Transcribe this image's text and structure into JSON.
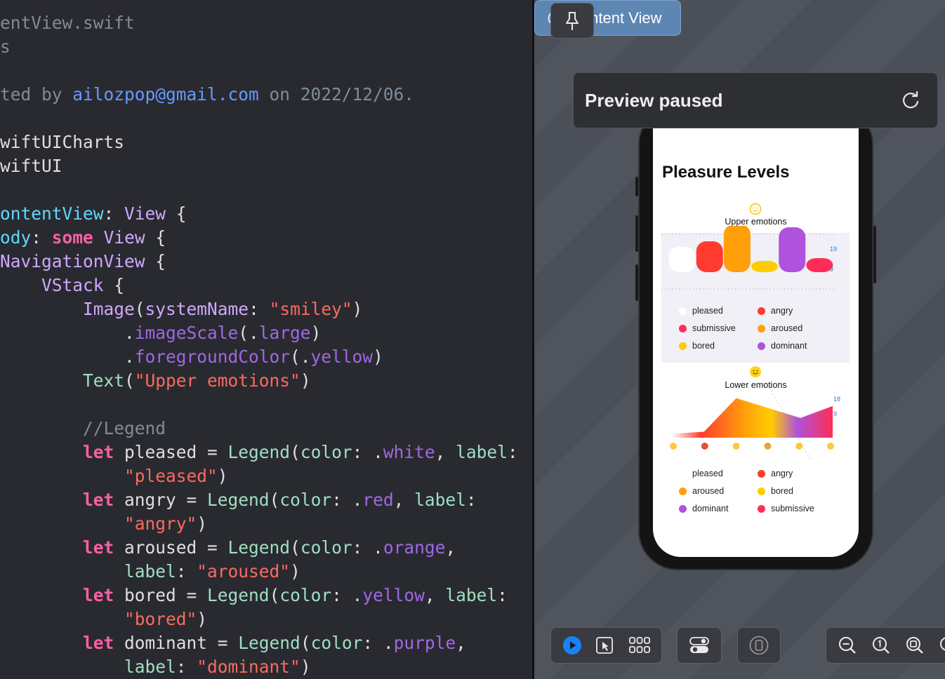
{
  "editor": {
    "lines": [
      [
        {
          "t": "entView.swift",
          "c": "comment"
        }
      ],
      [
        {
          "t": "s",
          "c": "comment"
        }
      ],
      [],
      [
        {
          "t": "ted by ",
          "c": "comment"
        },
        {
          "t": "ailozpop@gmail.com",
          "c": "link"
        },
        {
          "t": " on 2022/12/06.",
          "c": "comment"
        }
      ],
      [],
      [
        {
          "t": "wiftUICharts",
          "c": "plain"
        }
      ],
      [
        {
          "t": "wiftUI",
          "c": "plain"
        }
      ],
      [],
      [
        {
          "t": "ontentView",
          "c": "type"
        },
        {
          "t": ": ",
          "c": "plain"
        },
        {
          "t": "View",
          "c": "ptype"
        },
        {
          "t": " {",
          "c": "plain"
        }
      ],
      [
        {
          "t": "ody",
          "c": "type"
        },
        {
          "t": ": ",
          "c": "plain"
        },
        {
          "t": "some",
          "c": "kw"
        },
        {
          "t": " ",
          "c": "plain"
        },
        {
          "t": "View",
          "c": "ptype"
        },
        {
          "t": " {",
          "c": "plain"
        }
      ],
      [
        {
          "t": "NavigationView",
          "c": "ptype"
        },
        {
          "t": " {",
          "c": "plain"
        }
      ],
      [
        {
          "t": "    ",
          "c": "plain"
        },
        {
          "t": "VStack",
          "c": "ptype"
        },
        {
          "t": " {",
          "c": "plain"
        }
      ],
      [
        {
          "t": "        ",
          "c": "plain"
        },
        {
          "t": "Image",
          "c": "ptype"
        },
        {
          "t": "(",
          "c": "plain"
        },
        {
          "t": "systemName",
          "c": "ptype"
        },
        {
          "t": ": ",
          "c": "plain"
        },
        {
          "t": "\"smiley\"",
          "c": "str"
        },
        {
          "t": ")",
          "c": "plain"
        }
      ],
      [
        {
          "t": "            .",
          "c": "plain"
        },
        {
          "t": "imageScale",
          "c": "member"
        },
        {
          "t": "(.",
          "c": "plain"
        },
        {
          "t": "large",
          "c": "member"
        },
        {
          "t": ")",
          "c": "plain"
        }
      ],
      [
        {
          "t": "            .",
          "c": "plain"
        },
        {
          "t": "foregroundColor",
          "c": "member"
        },
        {
          "t": "(.",
          "c": "plain"
        },
        {
          "t": "yellow",
          "c": "member"
        },
        {
          "t": ")",
          "c": "plain"
        }
      ],
      [
        {
          "t": "        ",
          "c": "plain"
        },
        {
          "t": "Text",
          "c": "fn"
        },
        {
          "t": "(",
          "c": "plain"
        },
        {
          "t": "\"Upper emotions\"",
          "c": "str"
        },
        {
          "t": ")",
          "c": "plain"
        }
      ],
      [],
      [
        {
          "t": "        //Legend",
          "c": "comment"
        }
      ],
      [
        {
          "t": "        ",
          "c": "plain"
        },
        {
          "t": "let",
          "c": "kw"
        },
        {
          "t": " pleased = ",
          "c": "plain"
        },
        {
          "t": "Legend",
          "c": "fn"
        },
        {
          "t": "(",
          "c": "plain"
        },
        {
          "t": "color",
          "c": "param"
        },
        {
          "t": ": .",
          "c": "plain"
        },
        {
          "t": "white",
          "c": "member"
        },
        {
          "t": ", ",
          "c": "plain"
        },
        {
          "t": "label",
          "c": "param"
        },
        {
          "t": ":",
          "c": "plain"
        }
      ],
      [
        {
          "t": "            ",
          "c": "plain"
        },
        {
          "t": "\"pleased\"",
          "c": "str"
        },
        {
          "t": ")",
          "c": "plain"
        }
      ],
      [
        {
          "t": "        ",
          "c": "plain"
        },
        {
          "t": "let",
          "c": "kw"
        },
        {
          "t": " angry = ",
          "c": "plain"
        },
        {
          "t": "Legend",
          "c": "fn"
        },
        {
          "t": "(",
          "c": "plain"
        },
        {
          "t": "color",
          "c": "param"
        },
        {
          "t": ": .",
          "c": "plain"
        },
        {
          "t": "red",
          "c": "member"
        },
        {
          "t": ", ",
          "c": "plain"
        },
        {
          "t": "label",
          "c": "param"
        },
        {
          "t": ":",
          "c": "plain"
        }
      ],
      [
        {
          "t": "            ",
          "c": "plain"
        },
        {
          "t": "\"angry\"",
          "c": "str"
        },
        {
          "t": ")",
          "c": "plain"
        }
      ],
      [
        {
          "t": "        ",
          "c": "plain"
        },
        {
          "t": "let",
          "c": "kw"
        },
        {
          "t": " aroused = ",
          "c": "plain"
        },
        {
          "t": "Legend",
          "c": "fn"
        },
        {
          "t": "(",
          "c": "plain"
        },
        {
          "t": "color",
          "c": "param"
        },
        {
          "t": ": .",
          "c": "plain"
        },
        {
          "t": "orange",
          "c": "member"
        },
        {
          "t": ",",
          "c": "plain"
        }
      ],
      [
        {
          "t": "            ",
          "c": "plain"
        },
        {
          "t": "label",
          "c": "param"
        },
        {
          "t": ": ",
          "c": "plain"
        },
        {
          "t": "\"aroused\"",
          "c": "str"
        },
        {
          "t": ")",
          "c": "plain"
        }
      ],
      [
        {
          "t": "        ",
          "c": "plain"
        },
        {
          "t": "let",
          "c": "kw"
        },
        {
          "t": " bored = ",
          "c": "plain"
        },
        {
          "t": "Legend",
          "c": "fn"
        },
        {
          "t": "(",
          "c": "plain"
        },
        {
          "t": "color",
          "c": "param"
        },
        {
          "t": ": .",
          "c": "plain"
        },
        {
          "t": "yellow",
          "c": "member"
        },
        {
          "t": ", ",
          "c": "plain"
        },
        {
          "t": "label",
          "c": "param"
        },
        {
          "t": ":",
          "c": "plain"
        }
      ],
      [
        {
          "t": "            ",
          "c": "plain"
        },
        {
          "t": "\"bored\"",
          "c": "str"
        },
        {
          "t": ")",
          "c": "plain"
        }
      ],
      [
        {
          "t": "        ",
          "c": "plain"
        },
        {
          "t": "let",
          "c": "kw"
        },
        {
          "t": " dominant = ",
          "c": "plain"
        },
        {
          "t": "Legend",
          "c": "fn"
        },
        {
          "t": "(",
          "c": "plain"
        },
        {
          "t": "color",
          "c": "param"
        },
        {
          "t": ": .",
          "c": "plain"
        },
        {
          "t": "purple",
          "c": "member"
        },
        {
          "t": ",",
          "c": "plain"
        }
      ],
      [
        {
          "t": "            ",
          "c": "plain"
        },
        {
          "t": "label",
          "c": "param"
        },
        {
          "t": ": ",
          "c": "plain"
        },
        {
          "t": "\"dominant\"",
          "c": "str"
        },
        {
          "t": ")",
          "c": "plain"
        }
      ]
    ]
  },
  "preview": {
    "tab_label": "Content View",
    "banner_title": "Preview paused",
    "pin_icon": "pin-icon",
    "refresh_icon": "refresh-icon"
  },
  "app": {
    "nav_title": "Pleasure Levels",
    "upper_caption": "Upper emotions",
    "lower_caption": "Lower emotions"
  },
  "chart_data": [
    {
      "type": "bar",
      "title": "Upper emotions",
      "categories": [
        "pleased",
        "angry",
        "aroused",
        "bored",
        "dominant",
        "submissive"
      ],
      "values": [
        9,
        11,
        17,
        4,
        16,
        5
      ],
      "colors": [
        "#ffffff",
        "#ff3b30",
        "#ff9f0a",
        "#ffcc00",
        "#af52de",
        "#ff2d55"
      ],
      "y_tick_labels": [
        "19",
        "9"
      ],
      "ylim": [
        0,
        20
      ],
      "legend": [
        {
          "label": "pleased",
          "color": "#ffffff"
        },
        {
          "label": "angry",
          "color": "#ff3b30"
        },
        {
          "label": "submissive",
          "color": "#ff2d55"
        },
        {
          "label": "aroused",
          "color": "#ff9f0a"
        },
        {
          "label": "bored",
          "color": "#ffcc00"
        },
        {
          "label": "dominant",
          "color": "#af52de"
        }
      ]
    },
    {
      "type": "area",
      "title": "Lower emotions",
      "x": [
        1,
        2,
        3,
        4,
        5,
        6
      ],
      "values": [
        2,
        3,
        20,
        15,
        10,
        16
      ],
      "y_tick_labels": [
        "18",
        "9"
      ],
      "ylim": [
        0,
        22
      ],
      "legend": [
        {
          "label": "pleased",
          "color": "#ffffff"
        },
        {
          "label": "angry",
          "color": "#ff3b30"
        },
        {
          "label": "aroused",
          "color": "#ff9f0a"
        },
        {
          "label": "bored",
          "color": "#ffcc00"
        },
        {
          "label": "dominant",
          "color": "#af52de"
        },
        {
          "label": "submissive",
          "color": "#ff2d55"
        }
      ]
    }
  ],
  "toolbar": {
    "icons": [
      "play-icon",
      "select-icon",
      "grid-icon",
      "toggle-icon",
      "device-icon",
      "zoom-out-icon",
      "zoom-actual-icon",
      "zoom-in-icon"
    ]
  }
}
